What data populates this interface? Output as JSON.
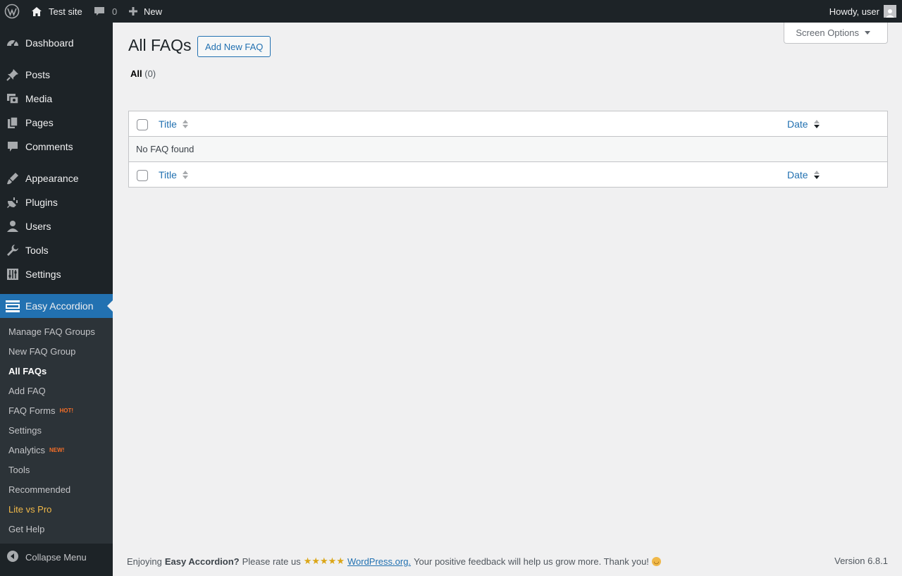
{
  "adminbar": {
    "site_name": "Test site",
    "comments_count": "0",
    "new_label": "New",
    "howdy": "Howdy, user"
  },
  "sidebar": {
    "items": [
      {
        "label": "Dashboard",
        "icon": "dashboard-icon"
      },
      {
        "label": "Posts",
        "icon": "pin-icon"
      },
      {
        "label": "Media",
        "icon": "media-icon"
      },
      {
        "label": "Pages",
        "icon": "pages-icon"
      },
      {
        "label": "Comments",
        "icon": "comment-icon"
      },
      {
        "label": "Appearance",
        "icon": "brush-icon"
      },
      {
        "label": "Plugins",
        "icon": "plug-icon"
      },
      {
        "label": "Users",
        "icon": "user-icon"
      },
      {
        "label": "Tools",
        "icon": "wrench-icon"
      },
      {
        "label": "Settings",
        "icon": "sliders-icon"
      },
      {
        "label": "Easy Accordion",
        "icon": "accordion-icon"
      }
    ],
    "submenu": [
      {
        "label": "Manage FAQ Groups"
      },
      {
        "label": "New FAQ Group"
      },
      {
        "label": "All FAQs"
      },
      {
        "label": "Add FAQ"
      },
      {
        "label": "FAQ Forms",
        "badge": "HOT!"
      },
      {
        "label": "Settings"
      },
      {
        "label": "Analytics",
        "badge": "NEW!"
      },
      {
        "label": "Tools"
      },
      {
        "label": "Recommended"
      },
      {
        "label": "Lite vs Pro"
      },
      {
        "label": "Get Help"
      }
    ],
    "collapse_label": "Collapse Menu"
  },
  "main": {
    "title": "All FAQs",
    "add_new_label": "Add New FAQ",
    "screen_options_label": "Screen Options",
    "filter_all": "All",
    "filter_count": "(0)",
    "table": {
      "col_title": "Title",
      "col_date": "Date",
      "empty": "No FAQ found"
    }
  },
  "footer": {
    "text_1": "Enjoying",
    "plugin": "Easy Accordion?",
    "text_2": "Please rate us",
    "stars": "★★★★★",
    "link": "WordPress.org.",
    "text_3": "Your positive feedback will help us grow more. Thank you!",
    "version": "Version 6.8.1"
  },
  "colors": {
    "accent": "#2271b1",
    "sidebar_bg": "#1d2327",
    "submenu_bg": "#2c3338",
    "badge": "#f56e28",
    "gold": "#f0b849"
  }
}
